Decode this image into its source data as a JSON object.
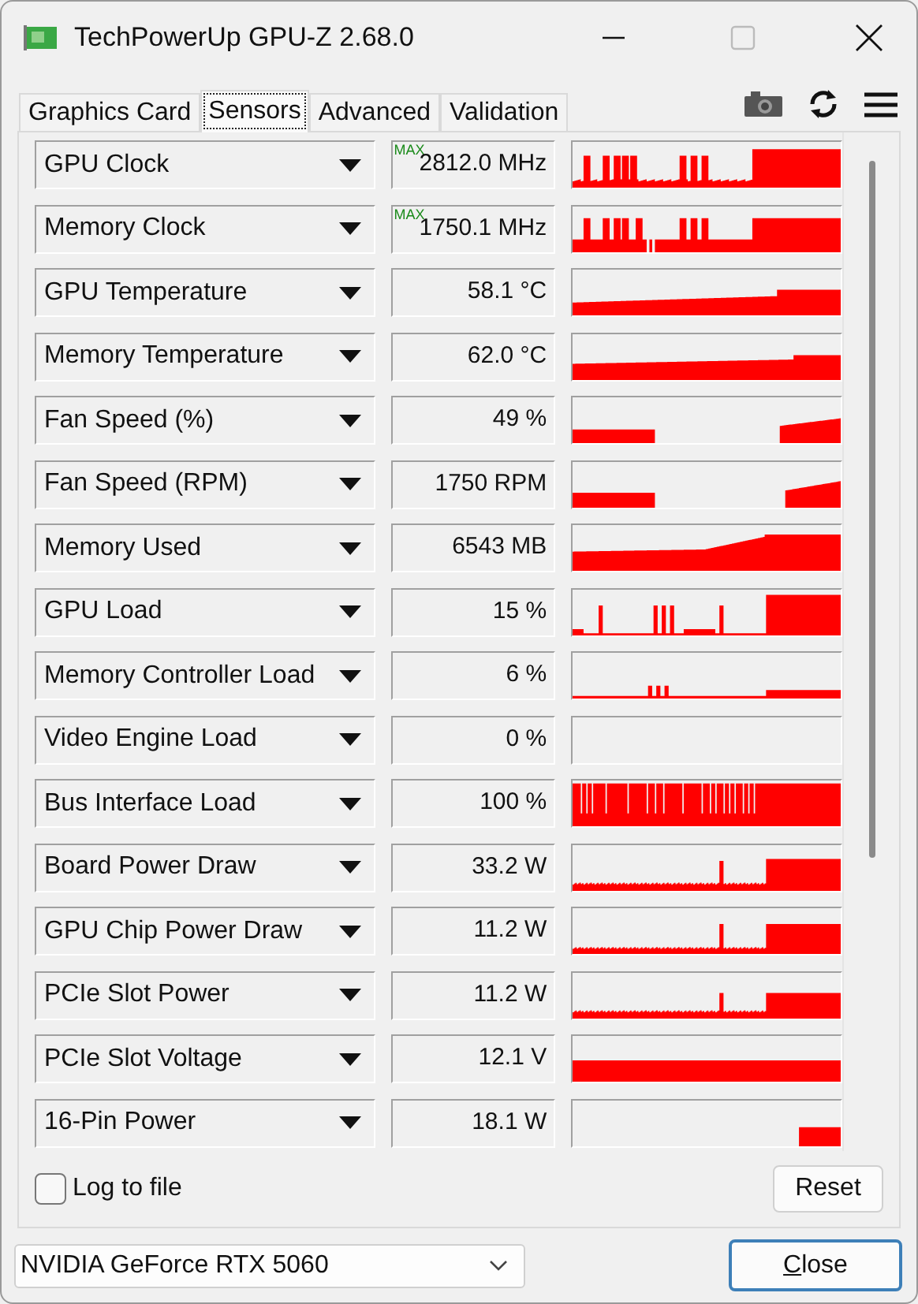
{
  "window": {
    "title": "TechPowerUp GPU-Z 2.68.0"
  },
  "tabs": [
    {
      "label": "Graphics Card",
      "selected": false
    },
    {
      "label": "Sensors",
      "selected": true
    },
    {
      "label": "Advanced",
      "selected": false
    },
    {
      "label": "Validation",
      "selected": false
    }
  ],
  "sensors": [
    {
      "name": "GPU Clock",
      "value": "2812.0 MHz",
      "badge": "MAX"
    },
    {
      "name": "Memory Clock",
      "value": "1750.1 MHz",
      "badge": "MAX"
    },
    {
      "name": "GPU Temperature",
      "value": "58.1 °C"
    },
    {
      "name": "Memory Temperature",
      "value": "62.0 °C"
    },
    {
      "name": "Fan Speed (%)",
      "value": "49 %"
    },
    {
      "name": "Fan Speed (RPM)",
      "value": "1750 RPM"
    },
    {
      "name": "Memory Used",
      "value": "6543 MB"
    },
    {
      "name": "GPU Load",
      "value": "15 %"
    },
    {
      "name": "Memory Controller Load",
      "value": "6 %"
    },
    {
      "name": "Video Engine Load",
      "value": "0 %"
    },
    {
      "name": "Bus Interface Load",
      "value": "100 %"
    },
    {
      "name": "Board Power Draw",
      "value": "33.2 W"
    },
    {
      "name": "GPU Chip Power Draw",
      "value": "11.2 W"
    },
    {
      "name": "PCIe Slot Power",
      "value": "11.2 W"
    },
    {
      "name": "PCIe Slot Voltage",
      "value": "12.1 V"
    },
    {
      "name": "16-Pin Power",
      "value": "18.1 W"
    }
  ],
  "log_to_file": {
    "label": "Log to file",
    "checked": false
  },
  "reset_button": {
    "label": "Reset"
  },
  "gpu_select": {
    "value": "NVIDIA GeForce RTX 5060"
  },
  "close_button": {
    "label": "Close",
    "mnemonic_underlined": true
  }
}
